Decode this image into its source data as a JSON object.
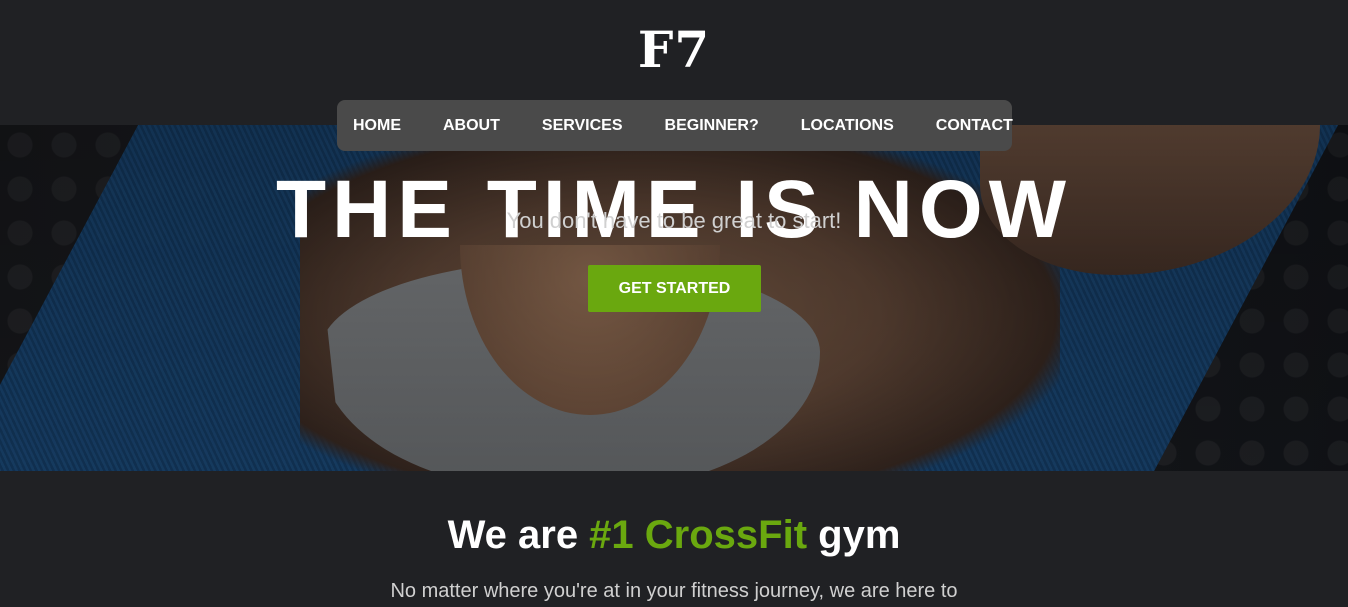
{
  "brand": {
    "logo": "F7"
  },
  "nav": {
    "items": [
      {
        "label": "HOME"
      },
      {
        "label": "ABOUT"
      },
      {
        "label": "SERVICES"
      },
      {
        "label": "BEGINNER?"
      },
      {
        "label": "LOCATIONS"
      },
      {
        "label": "CONTACT"
      }
    ]
  },
  "hero": {
    "title": "THE TIME IS NOW",
    "subtitle": "You don't have to be great to start!",
    "cta_label": "GET STARTED"
  },
  "intro": {
    "heading_before": "We are ",
    "heading_highlight": "#1 CrossFit",
    "heading_after": " gym",
    "text": "No matter where you're at in your fitness journey, we are here to"
  },
  "colors": {
    "background": "#202124",
    "nav_background": "#4a4a4a",
    "accent": "#6aa80f",
    "text": "#ffffff"
  }
}
